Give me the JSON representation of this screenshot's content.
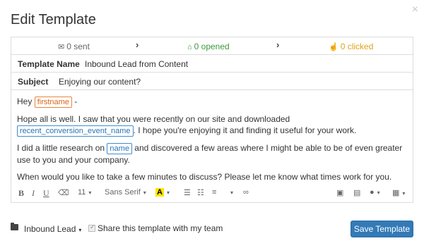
{
  "dialog": {
    "title": "Edit Template",
    "close_glyph": "×"
  },
  "stats": {
    "sent": "0 sent",
    "opened": "0 opened",
    "clicked": "0 clicked",
    "chevron": "›",
    "icons": {
      "sent": "envelope-icon",
      "opened": "open-envelope-icon",
      "clicked": "pointer-hand-icon"
    },
    "colors": {
      "opened": "#3b9a3b",
      "clicked": "#e3a21a"
    }
  },
  "template": {
    "name_label": "Template Name",
    "name_value": "Inbound Lead from Content",
    "subject_label": "Subject",
    "subject_value": "Enjoying our content?"
  },
  "body": {
    "greeting_prefix": "Hey",
    "token_firstname": "firstname",
    "greeting_suffix": "-",
    "p1_before": "Hope all is well. I saw that you were recently on our site and downloaded",
    "token_conversion": "recent_conversion_event_name",
    "p1_after": ". I hope you're enjoying it and finding it useful for your work.",
    "p2_before": "I did a little research on",
    "token_name": "name",
    "p2_after": "and discovered a few areas where I might be able to be of even greater use to you and your company.",
    "p3": "When would you like to take a few minutes to discuss? Please let me know what times work for you."
  },
  "toolbar": {
    "bold": "B",
    "italic": "I",
    "underline": "U",
    "eraser_glyph": "⌫",
    "font_size": "11",
    "font_family": "Sans Serif",
    "text_color_glyph": "A",
    "bullet_list_glyph": "☰",
    "numbered_list_glyph": "☷",
    "align_glyph": "≡",
    "link_glyph": "∞",
    "image_glyph": "▣",
    "video_glyph": "▤",
    "person_glyph": "●",
    "doc_glyph": "▦",
    "caret": "▾",
    "highlight_color": "#ffe400"
  },
  "footer": {
    "folder_name": "Inbound Lead",
    "share_label": "Share this template with my team",
    "save_label": "Save Template",
    "accent": "#337ab7"
  }
}
